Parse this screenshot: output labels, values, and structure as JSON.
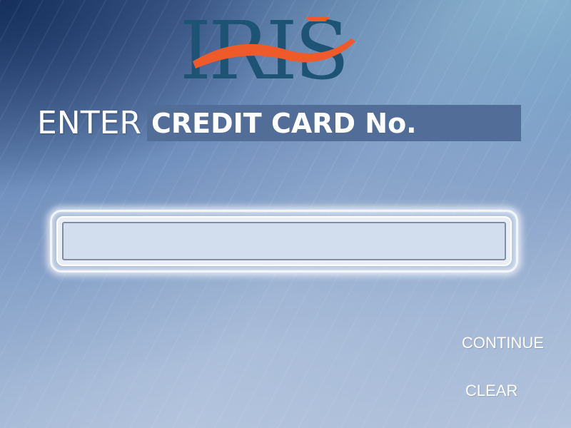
{
  "logo": {
    "text": "IRIS",
    "colors": {
      "letters": "#1d5476",
      "swoosh": "#ef5a2a"
    }
  },
  "title": {
    "prefix": "ENTER",
    "main": "CREDIT CARD No."
  },
  "card_input": {
    "value": "",
    "placeholder": ""
  },
  "buttons": {
    "continue_label": "CONTINUE",
    "clear_label": "CLEAR"
  },
  "colors": {
    "background_top": "#3e5b8c",
    "background_bottom": "#b3c4dc",
    "title_box": "#516d98",
    "input_fill": "#d2deee"
  }
}
